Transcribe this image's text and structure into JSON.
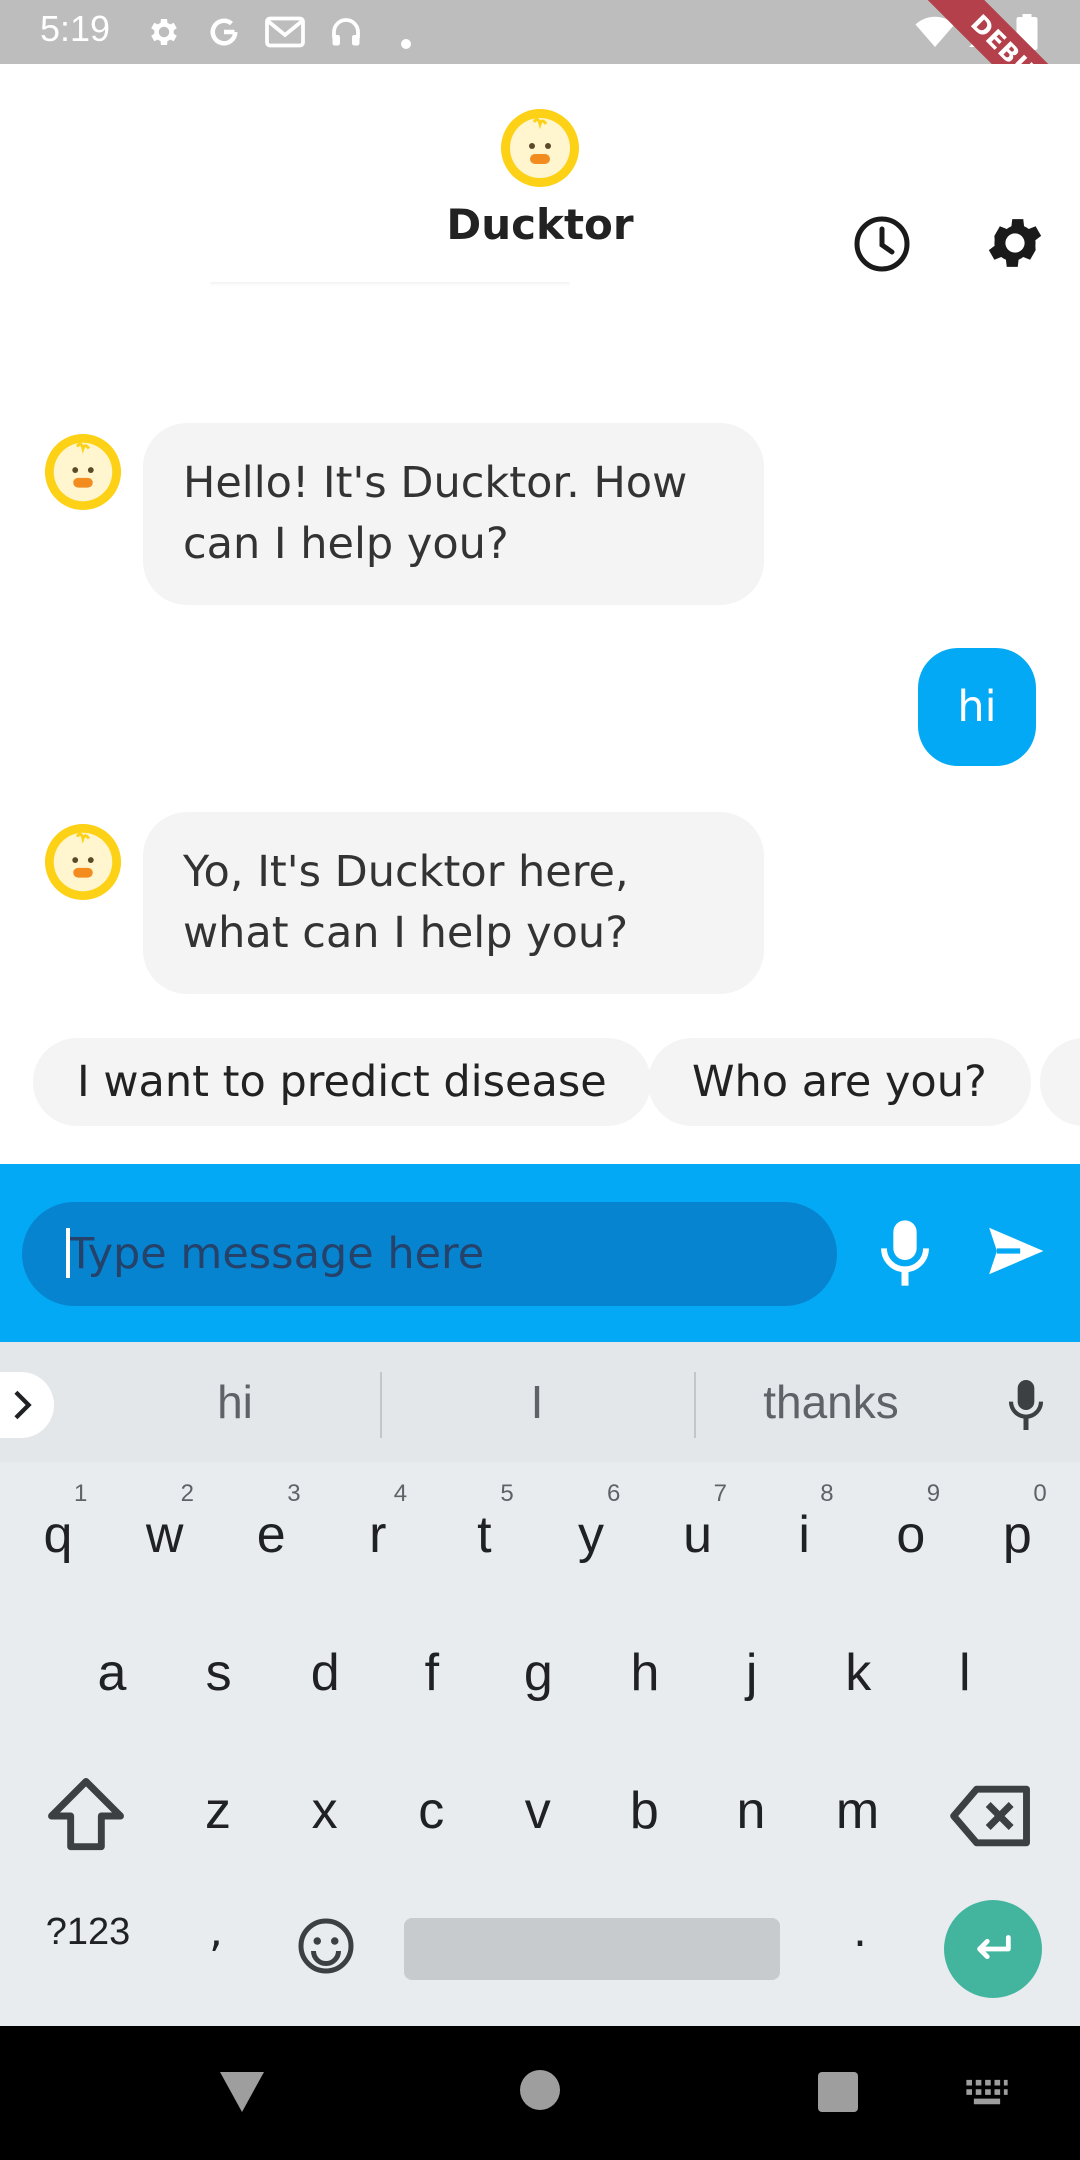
{
  "status_bar": {
    "time": "5:19"
  },
  "debug_banner": "DEBUG",
  "app_bar": {
    "title": "Ducktor"
  },
  "messages": [
    {
      "from": "bot",
      "text": "Hello! It's Ducktor. How can I help you?"
    },
    {
      "from": "user",
      "text": "hi"
    },
    {
      "from": "bot",
      "text": "Yo, It's Ducktor here, what can I help you?"
    }
  ],
  "suggestions": [
    "I want to predict disease",
    "Who are you?"
  ],
  "input": {
    "placeholder": "Type message here",
    "value": ""
  },
  "keyboard": {
    "suggestions": [
      "hi",
      "I",
      "thanks"
    ],
    "row1": [
      "q",
      "w",
      "e",
      "r",
      "t",
      "y",
      "u",
      "i",
      "o",
      "p"
    ],
    "row1_hints": [
      "1",
      "2",
      "3",
      "4",
      "5",
      "6",
      "7",
      "8",
      "9",
      "0"
    ],
    "row2": [
      "a",
      "s",
      "d",
      "f",
      "g",
      "h",
      "j",
      "k",
      "l"
    ],
    "row3": [
      "z",
      "x",
      "c",
      "v",
      "b",
      "n",
      "m"
    ],
    "symbols_label": "?123",
    "comma": ",",
    "period": "."
  },
  "colors": {
    "accent": "#03a9f4",
    "input_bg": "#0784d0",
    "bubble_bot": "#f4f4f5",
    "enter_key": "#43b59f",
    "duck_yellow": "#fcd116"
  },
  "icons": [
    "settings-status-icon",
    "google-icon",
    "gmail-icon",
    "headset-icon",
    "wifi-icon",
    "signal-icon",
    "battery-icon",
    "duck-logo-icon",
    "history-icon",
    "settings-icon",
    "mic-icon",
    "send-icon",
    "chevron-right-icon",
    "shift-icon",
    "backspace-icon",
    "emoji-icon",
    "enter-icon",
    "back-icon",
    "home-icon",
    "recents-icon",
    "keyboard-icon"
  ]
}
